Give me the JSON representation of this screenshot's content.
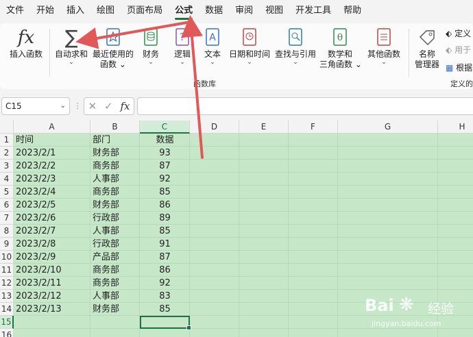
{
  "menu": {
    "tabs": [
      "文件",
      "开始",
      "插入",
      "绘图",
      "页面布局",
      "公式",
      "数据",
      "审阅",
      "视图",
      "开发工具",
      "帮助"
    ],
    "active_index": 5
  },
  "ribbon": {
    "insert_function": "插入函数",
    "autosum": "自动求和",
    "recent_1": "最近使用的",
    "recent_2": "函数",
    "financial": "财务",
    "logical": "逻辑",
    "text": "文本",
    "datetime": "日期和时间",
    "lookup": "查找与引用",
    "math_1": "数学和",
    "math_2": "三角函数",
    "more": "其他函数",
    "name_mgr_1": "名称",
    "name_mgr_2": "管理器",
    "define_name": "定义",
    "use_in_formula": "用于",
    "create_from_sel": "根据",
    "group_library": "函数库",
    "group_defined": "定义的"
  },
  "formula_bar": {
    "name_box": "C15",
    "formula": ""
  },
  "sheet": {
    "columns": [
      "A",
      "B",
      "C",
      "D",
      "E",
      "F",
      "G",
      "H"
    ],
    "selected_column": "C",
    "selected_row": 15,
    "rows": [
      1,
      2,
      3,
      4,
      5,
      6,
      7,
      8,
      9,
      10,
      11,
      12,
      13,
      14,
      15,
      16
    ],
    "header": [
      "时间",
      "部门",
      "数据"
    ],
    "data": [
      [
        "2023/2/1",
        "财务部",
        "93"
      ],
      [
        "2023/2/2",
        "商务部",
        "87"
      ],
      [
        "2023/2/3",
        "人事部",
        "92"
      ],
      [
        "2023/2/4",
        "商务部",
        "85"
      ],
      [
        "2023/2/5",
        "财务部",
        "86"
      ],
      [
        "2023/2/6",
        "行政部",
        "89"
      ],
      [
        "2023/2/7",
        "人事部",
        "85"
      ],
      [
        "2023/2/8",
        "行政部",
        "91"
      ],
      [
        "2023/2/9",
        "产品部",
        "87"
      ],
      [
        "2023/2/10",
        "商务部",
        "86"
      ],
      [
        "2023/2/11",
        "商务部",
        "92"
      ],
      [
        "2023/2/12",
        "人事部",
        "83"
      ],
      [
        "2023/2/13",
        "财务部",
        "85"
      ]
    ]
  },
  "watermark": {
    "brand": "Bai",
    "brand2": "经验",
    "url": "jingyan.baidu.com"
  },
  "colors": {
    "accent": "#1e7145",
    "sheet_bg": "#c6e8c9",
    "arrow": "#e05858"
  }
}
